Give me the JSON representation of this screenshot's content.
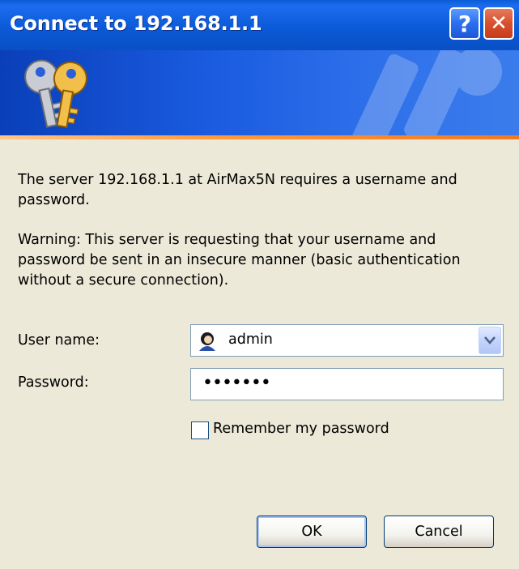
{
  "window": {
    "title": "Connect to 192.168.1.1",
    "help_label": "?",
    "close_label": "✕"
  },
  "message": {
    "line1": "The server 192.168.1.1 at AirMax5N requires a username and password.",
    "warning": "Warning: This server is requesting that your username and password be sent in an insecure manner (basic authentication without a secure connection)."
  },
  "form": {
    "username_label": "User name:",
    "username_value": "admin",
    "password_label": "Password:",
    "password_value": "•••••••",
    "remember_label": "Remember my password",
    "remember_checked": false
  },
  "buttons": {
    "ok": "OK",
    "cancel": "Cancel"
  },
  "icons": {
    "banner": "keys-icon",
    "user": "user-icon",
    "dropdown": "chevron-down-icon"
  }
}
